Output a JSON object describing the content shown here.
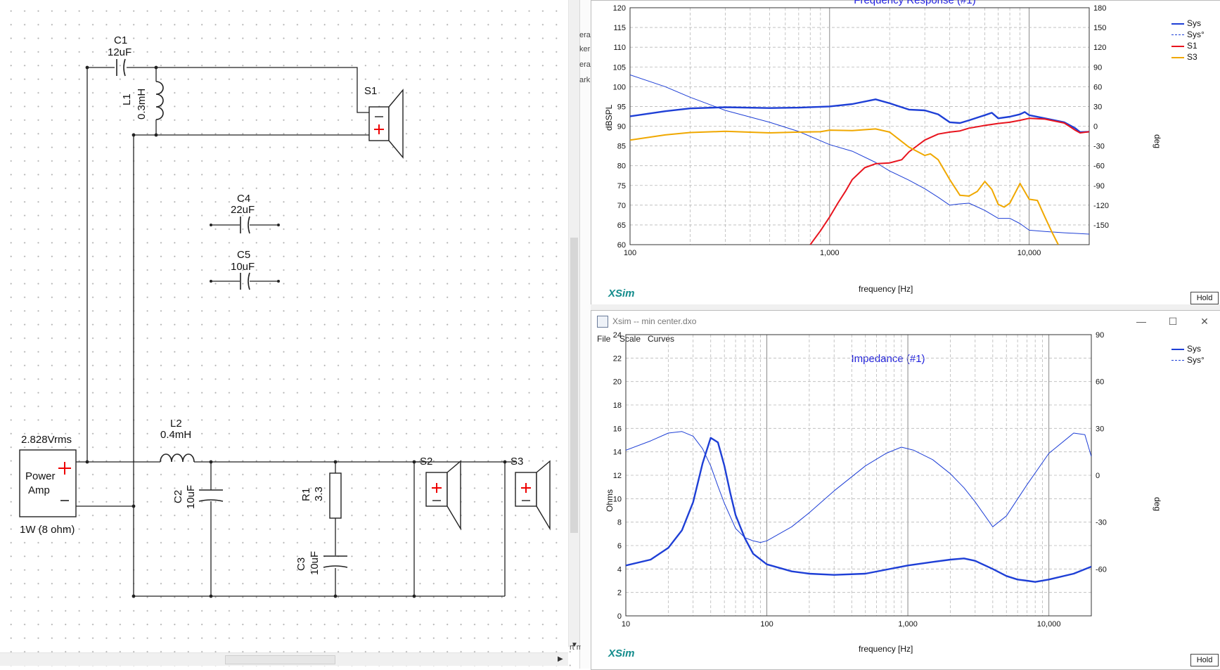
{
  "schematic": {
    "components": {
      "c1": {
        "name": "C1",
        "value": "12uF"
      },
      "l1": {
        "name": "L1",
        "value": "0.3mH"
      },
      "s1": {
        "name": "S1"
      },
      "c4": {
        "name": "C4",
        "value": "22uF"
      },
      "c5": {
        "name": "C5",
        "value": "10uF"
      },
      "l2": {
        "name": "L2",
        "value": "0.4mH"
      },
      "c2": {
        "name": "C2",
        "value": "10uF"
      },
      "r1": {
        "name": "R1",
        "value": "3.3"
      },
      "c3": {
        "name": "C3",
        "value": "10uF"
      },
      "s2": {
        "name": "S2"
      },
      "s3": {
        "name": "S3"
      }
    },
    "amp": {
      "voltage": "2.828Vrms",
      "line1": "Power",
      "line2": "Amp",
      "rating": "1W (8 ohm)"
    }
  },
  "strip_labels": [
    "era",
    "ker",
    "era",
    "ark",
    "rt mo"
  ],
  "frequency_window": {
    "title": "Frequency Response (#1)",
    "y_label": "dBSPL",
    "y2_label": "deg",
    "x_label": "frequency [Hz]",
    "y_ticks": [
      "120",
      "115",
      "110",
      "105",
      "100",
      "95",
      "90",
      "85",
      "80",
      "75",
      "70",
      "65",
      "60"
    ],
    "y2_ticks": [
      "180",
      "150",
      "120",
      "90",
      "60",
      "30",
      "0",
      "-30",
      "-60",
      "-90",
      "-120",
      "-150"
    ],
    "x_ticks": [
      "100",
      "1,000",
      "10,000"
    ],
    "brand": "XSim",
    "hold": "Hold",
    "legend": [
      {
        "name": "Sys",
        "color": "#1e3fd6",
        "style": "solid"
      },
      {
        "name": "Sys°",
        "color": "#1e3fd6",
        "style": "dashed"
      },
      {
        "name": "S1",
        "color": "#e8141e",
        "style": "solid"
      },
      {
        "name": "S3",
        "color": "#f0a800",
        "style": "solid"
      }
    ]
  },
  "impedance_window": {
    "window_title": "Xsim -- min center.dxo",
    "menu": [
      "File",
      "Scale",
      "Curves"
    ],
    "title": "Impedance (#1)",
    "y_label": "Ohms",
    "y2_label": "deg",
    "x_label": "frequency [Hz]",
    "y_ticks": [
      "24",
      "22",
      "20",
      "18",
      "16",
      "14",
      "12",
      "10",
      "8",
      "6",
      "4",
      "2",
      "0"
    ],
    "y2_ticks": [
      "90",
      "60",
      "30",
      "0",
      "-30",
      "-60"
    ],
    "x_ticks": [
      "10",
      "100",
      "1,000",
      "10,000"
    ],
    "brand": "XSim",
    "hold": "Hold",
    "legend": [
      {
        "name": "Sys",
        "color": "#1e3fd6",
        "style": "solid"
      },
      {
        "name": "Sys°",
        "color": "#1e3fd6",
        "style": "dashed"
      }
    ]
  },
  "chart_data": [
    {
      "type": "line",
      "title": "Frequency Response (#1)",
      "xlabel": "frequency [Hz]",
      "ylabel": "dBSPL",
      "y2label": "deg",
      "xscale": "log",
      "xlim": [
        100,
        20000
      ],
      "ylim": [
        60,
        120
      ],
      "y2lim": [
        -180,
        180
      ],
      "grid": true,
      "legend_position": "right",
      "series": [
        {
          "name": "Sys",
          "axis": "left",
          "color": "#1e3fd6",
          "width": 2.4,
          "x": [
            100,
            150,
            200,
            300,
            500,
            700,
            1000,
            1300,
            1700,
            2000,
            2500,
            3000,
            3500,
            4000,
            4500,
            5000,
            6000,
            6500,
            7000,
            8000,
            9000,
            9500,
            10000,
            12000,
            15000,
            17000,
            18000,
            20000
          ],
          "y": [
            92.5,
            93.8,
            94.5,
            94.8,
            94.6,
            94.7,
            95,
            95.6,
            96.8,
            95.8,
            94.2,
            94,
            93,
            91,
            90.8,
            91.5,
            92.8,
            93.4,
            92,
            92.4,
            93,
            93.6,
            92.8,
            92,
            91,
            89.5,
            88.5,
            88.6
          ]
        },
        {
          "name": "Sys°",
          "axis": "right",
          "color": "#1e3fd6",
          "width": 1,
          "x": [
            100,
            150,
            200,
            300,
            500,
            700,
            1000,
            1300,
            1700,
            2000,
            2500,
            3000,
            3500,
            4000,
            4500,
            5000,
            6000,
            7000,
            8000,
            9000,
            10000,
            12000,
            15000,
            20000
          ],
          "y": [
            78,
            60,
            44,
            24,
            6,
            -8,
            -28,
            -38,
            -55,
            -68,
            -82,
            -95,
            -108,
            -120,
            -118,
            -117,
            -128,
            -140,
            -140,
            -148,
            -158,
            -160,
            -162,
            -164
          ]
        },
        {
          "name": "S1",
          "axis": "left",
          "color": "#e8141e",
          "width": 2,
          "x": [
            800,
            900,
            1000,
            1100,
            1200,
            1300,
            1500,
            1700,
            2000,
            2300,
            2500,
            3000,
            3500,
            4000,
            4500,
            5000,
            6000,
            7000,
            8000,
            9000,
            10000,
            12000,
            15000,
            17000,
            18000,
            20000
          ],
          "y": [
            60,
            63.5,
            67,
            70.5,
            73.5,
            76.5,
            79.5,
            80.5,
            80.7,
            81.5,
            83.5,
            86.5,
            88,
            88.5,
            88.8,
            89.5,
            90.2,
            90.7,
            91,
            91.5,
            92,
            91.8,
            90.8,
            89,
            88.3,
            88.6
          ]
        },
        {
          "name": "S3",
          "axis": "left",
          "color": "#f0a800",
          "width": 2,
          "x": [
            100,
            150,
            200,
            300,
            500,
            700,
            900,
            1000,
            1300,
            1700,
            2000,
            2500,
            3000,
            3200,
            3500,
            4000,
            4500,
            5000,
            5500,
            6000,
            6500,
            7000,
            7500,
            8000,
            9000,
            10000,
            11000,
            12000,
            13000,
            14000
          ],
          "y": [
            86.5,
            87.8,
            88.4,
            88.7,
            88.3,
            88.5,
            88.6,
            89,
            88.9,
            89.3,
            88.5,
            84.7,
            82.6,
            83,
            81.5,
            76.5,
            72.5,
            72.3,
            73.5,
            76,
            74,
            70.2,
            69.5,
            70.5,
            75.5,
            71.5,
            71.2,
            67,
            63.2,
            60
          ]
        }
      ]
    },
    {
      "type": "line",
      "title": "Impedance (#1)",
      "xlabel": "frequency [Hz]",
      "ylabel": "Ohms",
      "y2label": "deg",
      "xscale": "log",
      "xlim": [
        10,
        20000
      ],
      "ylim": [
        0,
        24
      ],
      "y2lim": [
        -90,
        90
      ],
      "grid": true,
      "legend_position": "right",
      "series": [
        {
          "name": "Sys",
          "axis": "left",
          "color": "#1e3fd6",
          "width": 2.4,
          "x": [
            10,
            15,
            20,
            25,
            30,
            35,
            40,
            45,
            50,
            55,
            60,
            70,
            80,
            100,
            150,
            200,
            300,
            500,
            1000,
            1500,
            2000,
            2500,
            3000,
            4000,
            5000,
            6000,
            7000,
            8000,
            10000,
            15000,
            20000
          ],
          "y": [
            4.3,
            4.8,
            5.8,
            7.3,
            9.7,
            13,
            15.2,
            14.8,
            12.8,
            10.5,
            8.6,
            6.6,
            5.3,
            4.4,
            3.8,
            3.6,
            3.5,
            3.6,
            4.3,
            4.6,
            4.8,
            4.9,
            4.7,
            4,
            3.4,
            3.1,
            3,
            2.9,
            3.1,
            3.6,
            4.2
          ]
        },
        {
          "name": "Sys°",
          "axis": "right",
          "color": "#1e3fd6",
          "width": 1,
          "x": [
            10,
            15,
            20,
            25,
            30,
            35,
            40,
            45,
            50,
            60,
            70,
            80,
            90,
            100,
            150,
            200,
            300,
            500,
            700,
            900,
            1100,
            1500,
            2000,
            2500,
            3000,
            4000,
            5000,
            7000,
            10000,
            15000,
            18000,
            20000
          ],
          "y": [
            16,
            22,
            27,
            28,
            25,
            17,
            6,
            -7,
            -18,
            -34,
            -40,
            -42,
            -43,
            -42,
            -33,
            -24,
            -10,
            6,
            14,
            18,
            16,
            10,
            1,
            -8,
            -17,
            -33,
            -26,
            -6,
            14,
            27,
            26,
            12
          ]
        }
      ]
    }
  ]
}
